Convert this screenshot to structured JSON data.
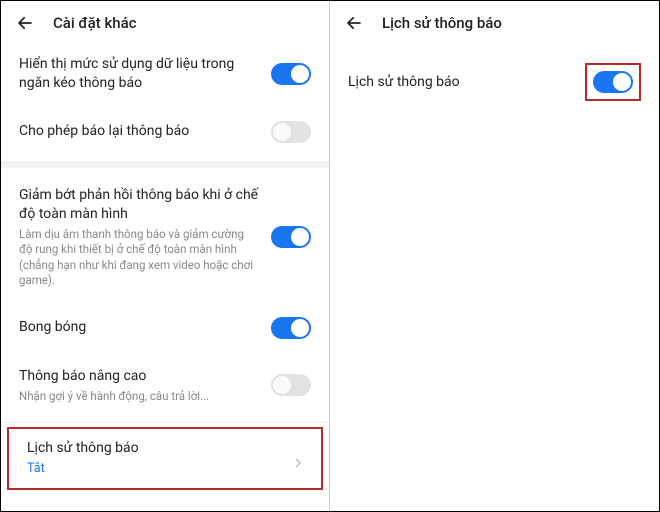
{
  "left": {
    "header_title": "Cài đặt khác",
    "items": [
      {
        "title": "Hiển thị mức sử dụng dữ liệu trong ngăn kéo thông báo",
        "toggle": true
      },
      {
        "title": "Cho phép báo lại thông báo",
        "toggle": false
      },
      {
        "title": "Giảm bớt phản hồi thông báo khi ở chế độ toàn màn hình",
        "sub": "Làm dịu âm thanh thông báo và giảm cường độ rung khi thiết bị ở chế độ toàn màn hình (chẳng hạn như khi đang xem video hoặc chơi game).",
        "toggle": true
      },
      {
        "title": "Bong bóng",
        "toggle": true
      },
      {
        "title": "Thông báo nâng cao",
        "sub": "Nhận gợi ý về hành động, câu trả lời...",
        "toggle": false
      },
      {
        "title": "Lịch sử thông báo",
        "sub_blue": "Tắt"
      }
    ]
  },
  "right": {
    "header_title": "Lịch sử thông báo",
    "row_title": "Lịch sử thông báo",
    "toggle": true
  }
}
